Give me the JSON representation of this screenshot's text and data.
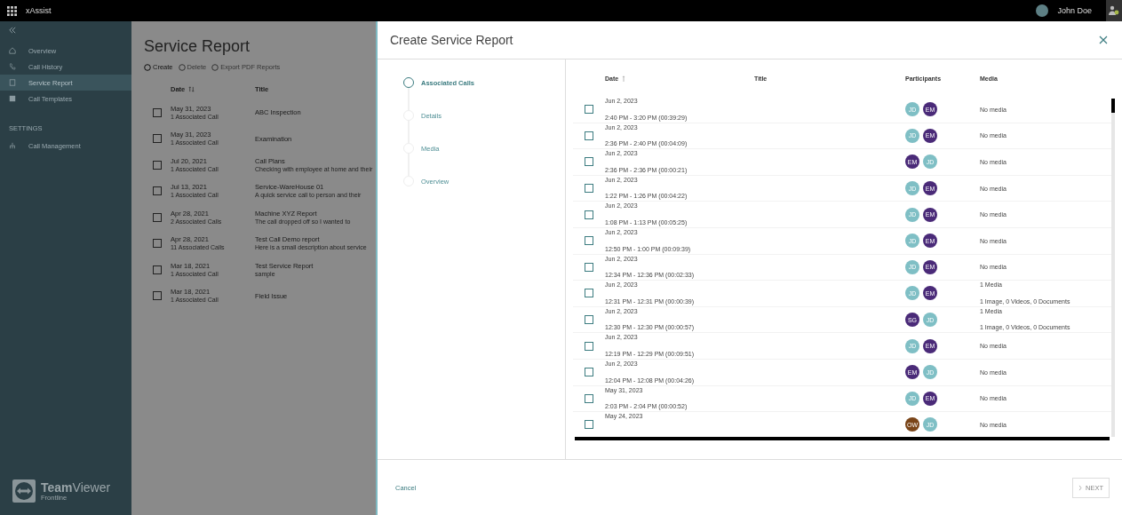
{
  "top_bar": {
    "app_name": "xAssist",
    "user_name": "John Doe"
  },
  "sidebar": {
    "items": [
      {
        "label": "Overview",
        "kind": "home",
        "selected": false
      },
      {
        "label": "Call History",
        "kind": "phone",
        "selected": false
      },
      {
        "label": "Service Report",
        "kind": "report",
        "selected": true
      },
      {
        "label": "Call Templates",
        "kind": "template",
        "selected": false
      }
    ],
    "settings_heading": "SETTINGS",
    "settings_items": [
      {
        "label": "Call Management",
        "kind": "org",
        "selected": false
      }
    ],
    "logo": {
      "bold": "Team",
      "light": "Viewer",
      "tagline": "Frontline"
    }
  },
  "page": {
    "title": "Service Report",
    "toolbar": [
      {
        "label": "Create",
        "disabled": false
      },
      {
        "label": "Delete",
        "disabled": true
      },
      {
        "label": "Export PDF Reports",
        "disabled": true
      }
    ],
    "columns": [
      "Date",
      "Title"
    ],
    "rows": [
      {
        "checked": false,
        "date": "May 31, 2023",
        "calls": "1 Associated Call",
        "title": "ABC Inspection"
      },
      {
        "checked": false,
        "date": "May 31, 2023",
        "calls": "1 Associated Call",
        "title": "Examination"
      },
      {
        "checked": false,
        "date": "Jul 20, 2021",
        "calls": "1 Associated Call",
        "title": "Call Plans",
        "description": "Checking with employee at home and their"
      },
      {
        "checked": false,
        "date": "Jul 13, 2021",
        "calls": "1 Associated Call",
        "title": "Service-WareHouse 01",
        "description": "A quick service call to person and their"
      },
      {
        "checked": false,
        "date": "Apr 28, 2021",
        "calls": "2 Associated Calls",
        "title": "Machine XYZ Report",
        "description": "The call dropped off so I wanted to"
      },
      {
        "checked": false,
        "date": "Apr 28, 2021",
        "calls": "11 Associated Calls",
        "title": "Test Call Demo report",
        "description": "Here is a small description about service"
      },
      {
        "checked": false,
        "date": "Mar 18, 2021",
        "calls": "1 Associated Call",
        "title": "Test Service Report",
        "description": "sample"
      },
      {
        "checked": false,
        "date": "Mar 18, 2021",
        "calls": "1 Associated Call",
        "title": "Field Issue"
      }
    ]
  },
  "dialog": {
    "title": "Create Service Report",
    "steps": [
      {
        "label": "Associated Calls",
        "selected": true
      },
      {
        "label": "Details",
        "selected": false
      },
      {
        "label": "Media",
        "selected": false
      },
      {
        "label": "Overview",
        "selected": false
      }
    ],
    "columns": [
      "Date",
      "Title",
      "Participants",
      "Media"
    ],
    "rows": [
      {
        "checked": false,
        "date": "Jun 2, 2023",
        "time": "2:40 PM - 3:20 PM (00:39:29)",
        "participants": [
          {
            "initials": "JD",
            "color": "#7fbfc5"
          },
          {
            "initials": "EM",
            "color": "#4a2a78"
          }
        ],
        "media": "No media"
      },
      {
        "checked": false,
        "date": "Jun 2, 2023",
        "time": "2:36 PM - 2:40 PM (00:04:09)",
        "participants": [
          {
            "initials": "JD",
            "color": "#7fbfc5"
          },
          {
            "initials": "EM",
            "color": "#4a2a78"
          }
        ],
        "media": "No media"
      },
      {
        "checked": false,
        "date": "Jun 2, 2023",
        "time": "2:36 PM - 2:36 PM (00:00:21)",
        "participants": [
          {
            "initials": "EM",
            "color": "#4a2a78"
          },
          {
            "initials": "JD",
            "color": "#7fbfc5"
          }
        ],
        "media": "No media"
      },
      {
        "checked": false,
        "date": "Jun 2, 2023",
        "time": "1:22 PM - 1:26 PM (00:04:22)",
        "participants": [
          {
            "initials": "JD",
            "color": "#7fbfc5"
          },
          {
            "initials": "EM",
            "color": "#4a2a78"
          }
        ],
        "media": "No media"
      },
      {
        "checked": false,
        "date": "Jun 2, 2023",
        "time": "1:08 PM - 1:13 PM (00:05:25)",
        "participants": [
          {
            "initials": "JD",
            "color": "#7fbfc5"
          },
          {
            "initials": "EM",
            "color": "#4a2a78"
          }
        ],
        "media": "No media"
      },
      {
        "checked": false,
        "date": "Jun 2, 2023",
        "time": "12:50 PM - 1:00 PM (00:09:39)",
        "participants": [
          {
            "initials": "JD",
            "color": "#7fbfc5"
          },
          {
            "initials": "EM",
            "color": "#4a2a78"
          }
        ],
        "media": "No media"
      },
      {
        "checked": false,
        "date": "Jun 2, 2023",
        "time": "12:34 PM - 12:36 PM (00:02:33)",
        "participants": [
          {
            "initials": "JD",
            "color": "#7fbfc5"
          },
          {
            "initials": "EM",
            "color": "#4a2a78"
          }
        ],
        "media": "No media"
      },
      {
        "checked": false,
        "date": "Jun 2, 2023",
        "time": "12:31 PM - 12:31 PM (00:00:39)",
        "participants": [
          {
            "initials": "JD",
            "color": "#7fbfc5"
          },
          {
            "initials": "EM",
            "color": "#4a2a78"
          }
        ],
        "media": "1 Media",
        "media_detail": "1 Image, 0 Videos, 0 Documents"
      },
      {
        "checked": false,
        "date": "Jun 2, 2023",
        "time": "12:30 PM - 12:30 PM (00:00:57)",
        "participants": [
          {
            "initials": "SG",
            "color": "#4a2a78"
          },
          {
            "initials": "JD",
            "color": "#7fbfc5"
          }
        ],
        "media": "1 Media",
        "media_detail": "1 Image, 0 Videos, 0 Documents"
      },
      {
        "checked": false,
        "date": "Jun 2, 2023",
        "time": "12:19 PM - 12:29 PM (00:09:51)",
        "participants": [
          {
            "initials": "JD",
            "color": "#7fbfc5"
          },
          {
            "initials": "EM",
            "color": "#4a2a78"
          }
        ],
        "media": "No media"
      },
      {
        "checked": false,
        "date": "Jun 2, 2023",
        "time": "12:04 PM - 12:08 PM (00:04:26)",
        "participants": [
          {
            "initials": "EM",
            "color": "#4a2a78"
          },
          {
            "initials": "JD",
            "color": "#7fbfc5"
          }
        ],
        "media": "No media"
      },
      {
        "checked": false,
        "date": "May 31, 2023",
        "time": "2:03 PM - 2:04 PM (00:00:52)",
        "participants": [
          {
            "initials": "JD",
            "color": "#7fbfc5"
          },
          {
            "initials": "EM",
            "color": "#4a2a78"
          }
        ],
        "media": "No media"
      },
      {
        "checked": false,
        "date": "May 24, 2023",
        "participants": [
          {
            "initials": "OW",
            "color": "#7a4519"
          },
          {
            "initials": "JD",
            "color": "#7fbfc5"
          }
        ],
        "media": "No media"
      }
    ],
    "cancel": "Cancel",
    "next": {
      "label": "NEXT",
      "disabled": true
    }
  }
}
